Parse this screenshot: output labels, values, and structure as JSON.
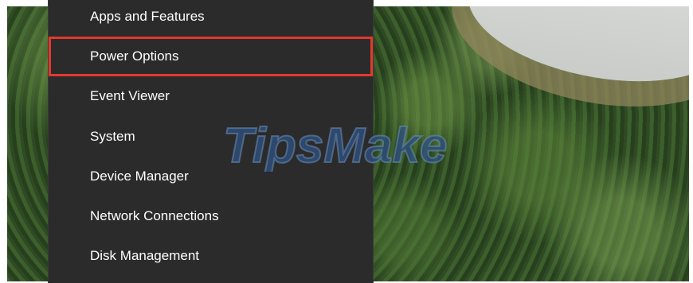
{
  "context_menu": {
    "items": [
      {
        "label": "Apps and Features"
      },
      {
        "label": "Power Options"
      },
      {
        "label": "Event Viewer"
      },
      {
        "label": "System"
      },
      {
        "label": "Device Manager"
      },
      {
        "label": "Network Connections"
      },
      {
        "label": "Disk Management"
      }
    ],
    "selected": "Power Options",
    "highlight_color": "#e3392d",
    "background_color": "#2b2b2b"
  },
  "watermark": {
    "text": "TipsMake",
    "color": "#2f4f7f"
  }
}
